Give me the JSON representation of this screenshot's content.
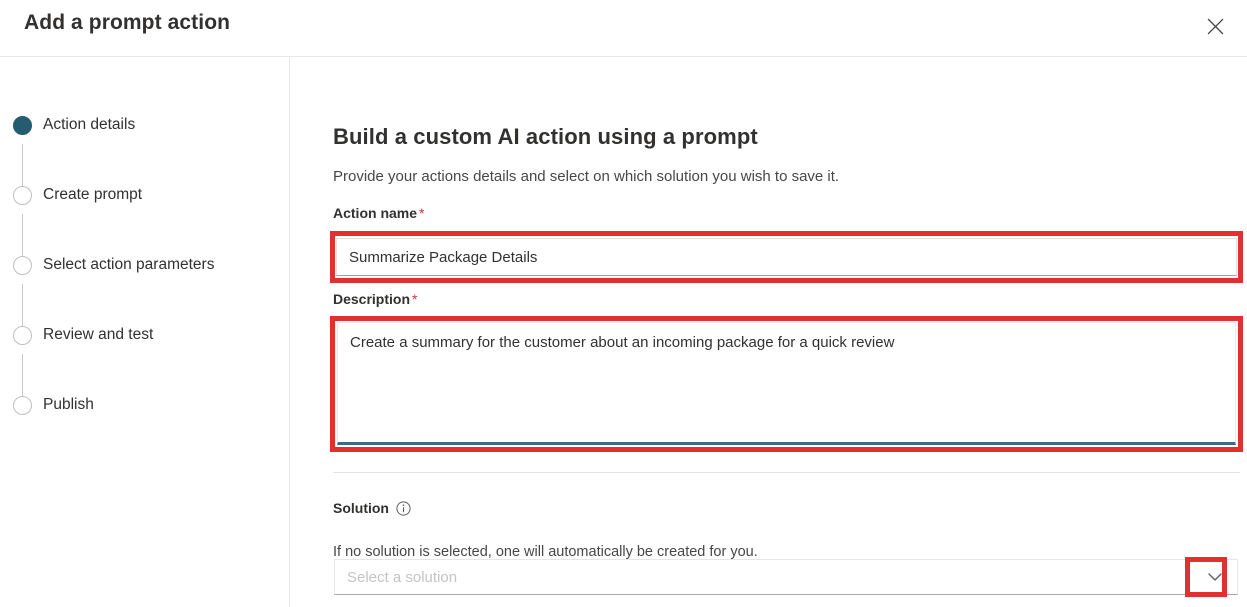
{
  "dialog": {
    "title": "Add a prompt action",
    "close_icon": "close-icon"
  },
  "stepper": {
    "steps": [
      {
        "label": "Action details",
        "state": "active"
      },
      {
        "label": "Create prompt",
        "state": "inactive"
      },
      {
        "label": "Select action parameters",
        "state": "inactive"
      },
      {
        "label": "Review and test",
        "state": "inactive"
      },
      {
        "label": "Publish",
        "state": "inactive"
      }
    ]
  },
  "main": {
    "heading": "Build a custom AI action using a prompt",
    "subheading": "Provide your actions details and select on which solution you wish to save it.",
    "action_name": {
      "label": "Action name",
      "required_marker": "*",
      "value": "Summarize Package Details",
      "placeholder": ""
    },
    "description": {
      "label": "Description",
      "required_marker": "*",
      "value": "Create a summary for the customer about an incoming package for a quick review",
      "placeholder": ""
    },
    "solution": {
      "label": "Solution",
      "info_icon": "info-icon",
      "help_text": "If no solution is selected, one will automatically be created for you.",
      "placeholder": "Select a solution",
      "selected_value": "",
      "chevron_icon": "chevron-down-icon"
    }
  },
  "annotations": {
    "highlight_color": "#e03030",
    "targets": [
      "action-name-input",
      "description-textarea",
      "solution-dropdown-chevron"
    ]
  },
  "colors": {
    "accent": "#245d72",
    "required": "#d13438",
    "text": "#323130",
    "muted": "#474747",
    "focus_underline": "#3d6b83"
  }
}
